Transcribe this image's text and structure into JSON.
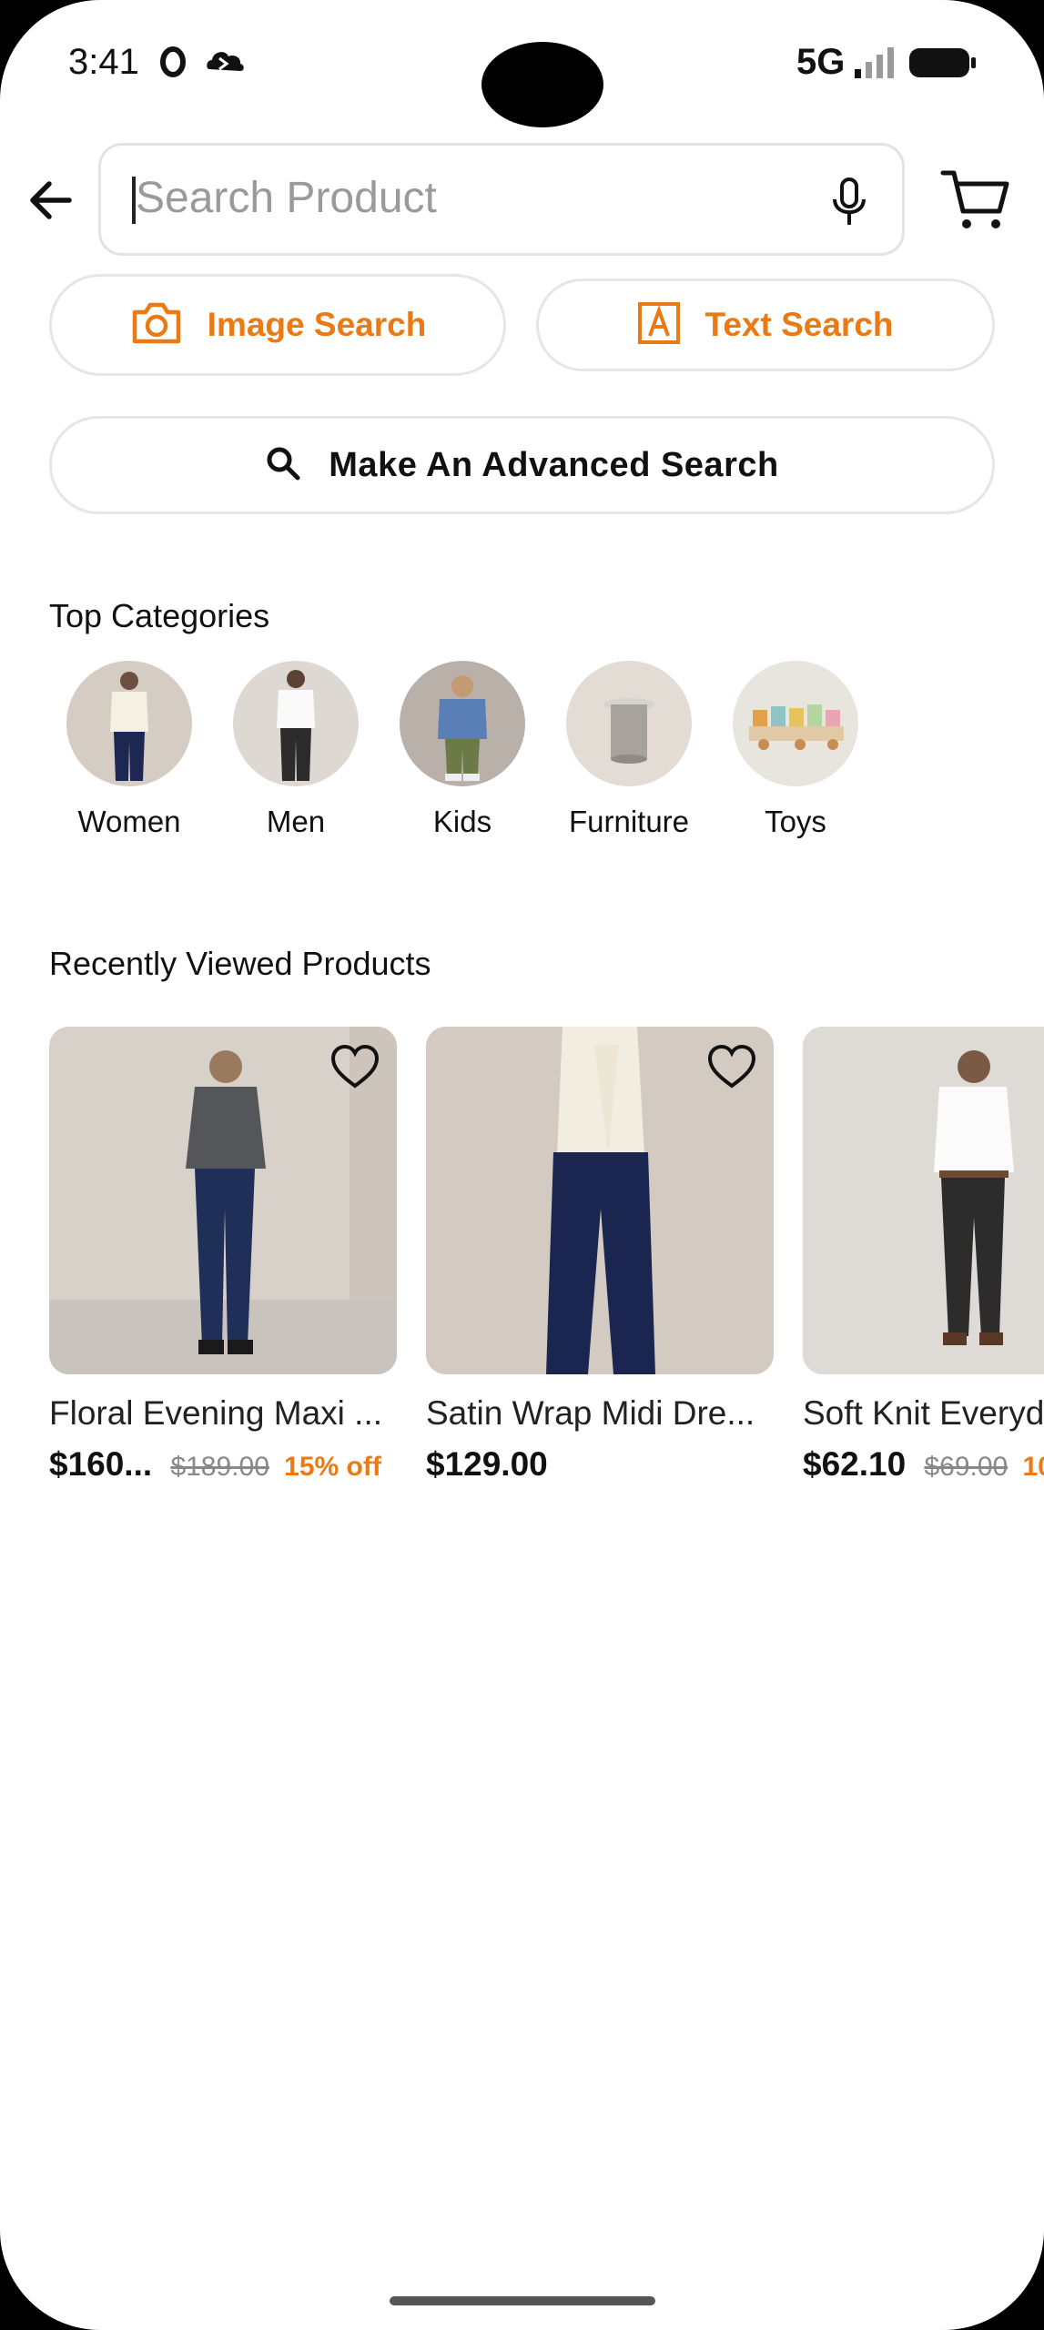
{
  "status_bar": {
    "time": "3:41",
    "network": "5G"
  },
  "search": {
    "placeholder": "Search Product"
  },
  "buttons": {
    "image_search": "Image Search",
    "text_search": "Text Search",
    "advanced_search": "Make An Advanced Search"
  },
  "top_categories": {
    "title": "Top Categories",
    "items": [
      {
        "label": "Women"
      },
      {
        "label": "Men"
      },
      {
        "label": "Kids"
      },
      {
        "label": "Furniture"
      },
      {
        "label": "Toys"
      }
    ]
  },
  "recent": {
    "title": "Recently Viewed Products",
    "products": [
      {
        "title": "Floral Evening Maxi ...",
        "price": "$160...",
        "old_price": "$189.00",
        "discount": "15% off"
      },
      {
        "title": "Satin Wrap Midi Dre...",
        "price": "$129.00",
        "old_price": "",
        "discount": ""
      },
      {
        "title": "Soft Knit Everyd",
        "price": "$62.10",
        "old_price": "$69.00",
        "discount": "10"
      }
    ]
  },
  "colors": {
    "accent": "#ea7a14",
    "text": "#111111",
    "border": "#e6e6e6"
  }
}
